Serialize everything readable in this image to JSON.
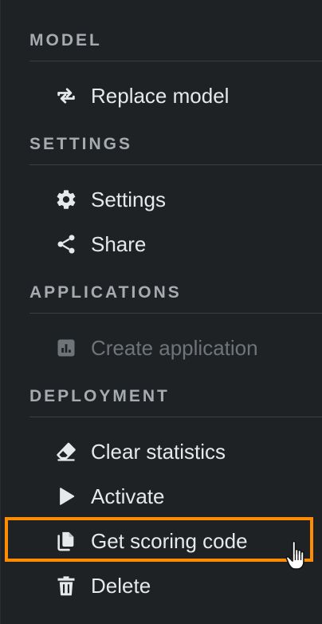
{
  "sections": {
    "model": {
      "header": "MODEL",
      "items": [
        {
          "label": "Replace model",
          "icon": "replace-icon"
        }
      ]
    },
    "settings": {
      "header": "SETTINGS",
      "items": [
        {
          "label": "Settings",
          "icon": "gear-icon"
        },
        {
          "label": "Share",
          "icon": "share-icon"
        }
      ]
    },
    "applications": {
      "header": "APPLICATIONS",
      "items": [
        {
          "label": "Create application",
          "icon": "chart-icon",
          "disabled": true
        }
      ]
    },
    "deployment": {
      "header": "DEPLOYMENT",
      "items": [
        {
          "label": "Clear statistics",
          "icon": "eraser-icon"
        },
        {
          "label": "Activate",
          "icon": "play-icon"
        },
        {
          "label": "Get scoring code",
          "icon": "copy-icon",
          "highlighted": true
        },
        {
          "label": "Delete",
          "icon": "trash-icon"
        }
      ]
    }
  },
  "colors": {
    "background": "#1f2224",
    "header_text": "#a6abaf",
    "item_text": "#e6e8ea",
    "disabled_text": "#6f7478",
    "highlight": "#ff8c00"
  }
}
